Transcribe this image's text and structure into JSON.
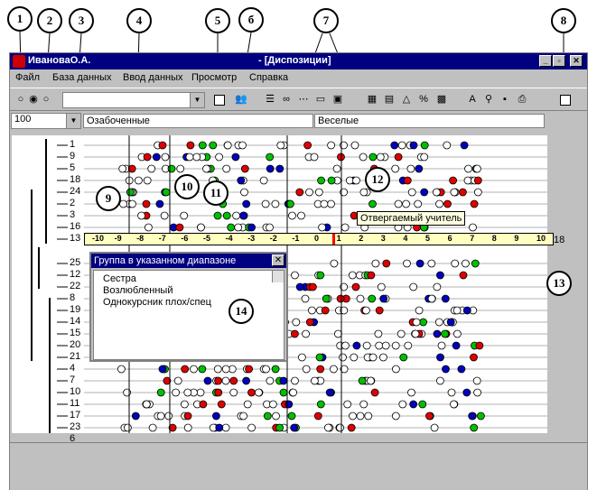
{
  "callouts": [
    "1",
    "2",
    "3",
    "4",
    "5",
    "б",
    "7",
    "8",
    "9",
    "10",
    "11",
    "12",
    "13",
    "14"
  ],
  "window": {
    "user": "ИвановаО.А.",
    "doc_title": "- [Диспозиции]",
    "minimize": "_",
    "restore": "▫",
    "close": "✕"
  },
  "menu": {
    "items": [
      "Файл",
      "База данных",
      "Ввод данных",
      "Просмотр",
      "Справка"
    ]
  },
  "toolbar": {
    "zoom_value": "100",
    "group_combo_value": "",
    "icons": [
      "radio-group-icon",
      "checkbox-icon",
      "people-icon",
      "list-icon",
      "grid-icon",
      "chart-icon",
      "font-icon",
      "search-icon",
      "save-icon",
      "print-icon"
    ]
  },
  "fields": {
    "left_construct": "Озабоченные",
    "right_construct": "Веселые"
  },
  "rows": {
    "labels": [
      "1",
      "9",
      "5",
      "18",
      "24",
      "2",
      "3",
      "16",
      "13",
      "25",
      "12",
      "22",
      "8",
      "19",
      "14",
      "15",
      "20",
      "21",
      "4",
      "7",
      "10",
      "11",
      "17",
      "23",
      "6"
    ]
  },
  "scale": {
    "ticks": [
      "-10",
      "-9",
      "-8",
      "-7",
      "-6",
      "-5",
      "-4",
      "-3",
      "-2",
      "-1",
      "0",
      "1",
      "2",
      "3",
      "4",
      "5",
      "6",
      "7",
      "8",
      "9",
      "10"
    ],
    "right_value": "18"
  },
  "tooltip": {
    "text": "Отвергаемый учитель"
  },
  "dialog": {
    "title": "Группа в указанном диапазоне",
    "close": "✕",
    "items": [
      "Сестра",
      "Возлюбленный",
      "Однокурсник плох/спец"
    ]
  },
  "colors": {
    "title_bg": "#000080",
    "scale_bg": "#ffffc0",
    "marker_red": "#ff0000",
    "dot_green": "#00c000",
    "dot_blue": "#0000c0",
    "dot_red": "#e00000"
  }
}
